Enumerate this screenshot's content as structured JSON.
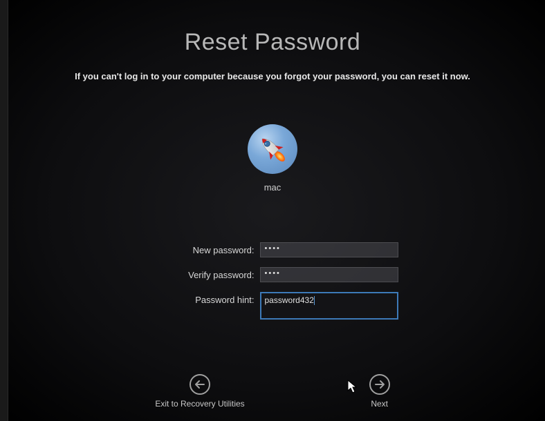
{
  "header": {
    "title": "Reset Password",
    "subtitle": "If you can't log in to your computer because you forgot your password, you can reset it now."
  },
  "user": {
    "name": "mac"
  },
  "form": {
    "new_password": {
      "label": "New password:",
      "value": "••••"
    },
    "verify_password": {
      "label": "Verify password:",
      "value": "••••"
    },
    "password_hint": {
      "label": "Password hint:",
      "value": "password432"
    }
  },
  "nav": {
    "back": {
      "label": "Exit to Recovery Utilities"
    },
    "next": {
      "label": "Next"
    }
  }
}
